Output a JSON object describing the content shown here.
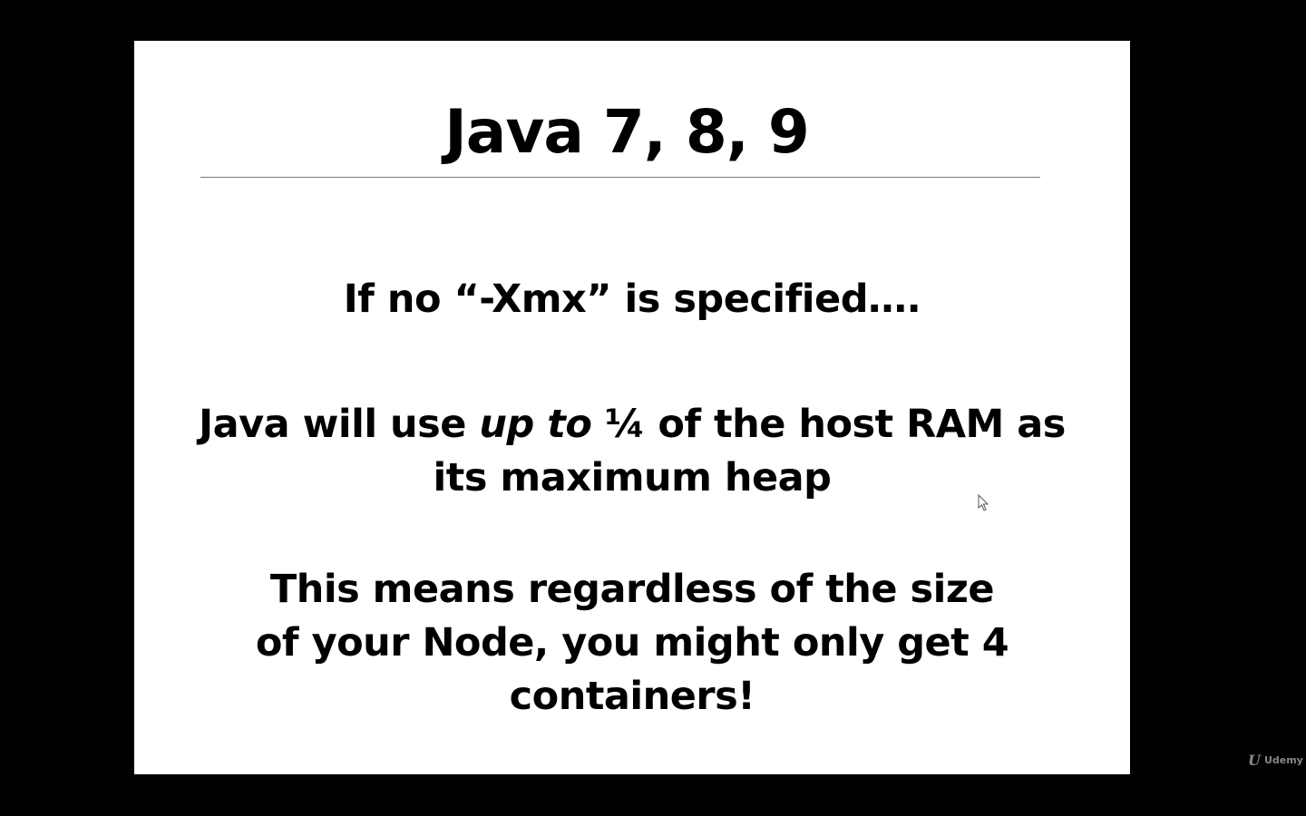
{
  "slide": {
    "title": "Java 7, 8, 9",
    "p1": "If no “-Xmx” is specified….",
    "p2_before": "Java will use ",
    "p2_em": "up to",
    "p2_after": " ¼ of the host RAM as its maximum heap",
    "p3": "This means regardless of the size of your Node, you might only get 4 containers!"
  },
  "watermark": {
    "logo": "U",
    "text": "Udemy"
  }
}
